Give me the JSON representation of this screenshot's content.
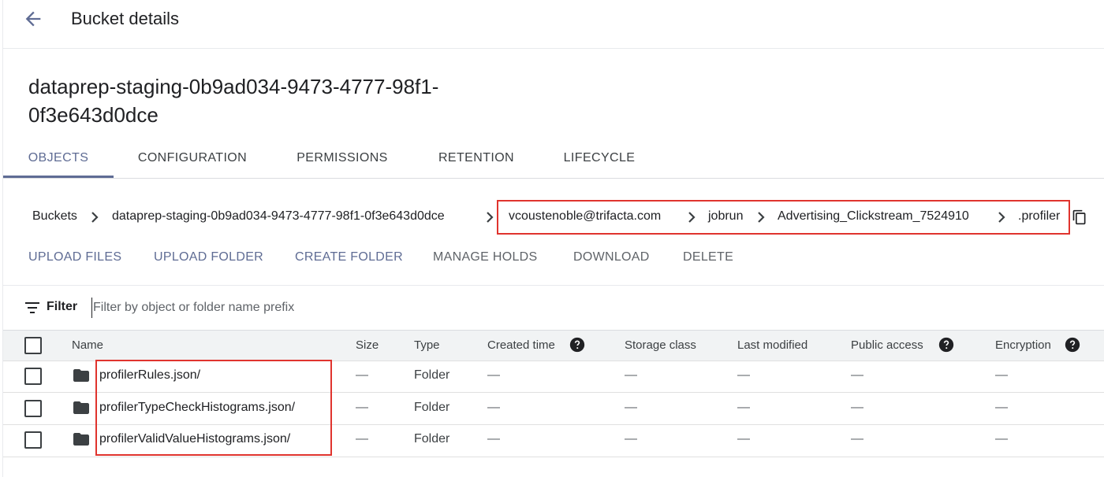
{
  "header": {
    "title": "Bucket details",
    "back_icon": "arrow-back-icon"
  },
  "bucket": {
    "name_line1": "dataprep-staging-0b9ad034-9473-4777-98f1-",
    "name_line2": "0f3e643d0dce"
  },
  "tabs": [
    {
      "label": "OBJECTS",
      "active": true
    },
    {
      "label": "CONFIGURATION",
      "active": false
    },
    {
      "label": "PERMISSIONS",
      "active": false
    },
    {
      "label": "RETENTION",
      "active": false
    },
    {
      "label": "LIFECYCLE",
      "active": false
    }
  ],
  "breadcrumb": [
    "Buckets",
    "dataprep-staging-0b9ad034-9473-4777-98f1-0f3e643d0dce",
    "vcoustenoble@trifacta.com",
    "jobrun",
    "Advertising_Clickstream_7524910",
    ".profiler"
  ],
  "actions": [
    {
      "label": "UPLOAD FILES",
      "enabled": true
    },
    {
      "label": "UPLOAD FOLDER",
      "enabled": true
    },
    {
      "label": "CREATE FOLDER",
      "enabled": true
    },
    {
      "label": "MANAGE HOLDS",
      "enabled": false
    },
    {
      "label": "DOWNLOAD",
      "enabled": false
    },
    {
      "label": "DELETE",
      "enabled": false
    }
  ],
  "filter": {
    "label": "Filter",
    "placeholder": "Filter by object or folder name prefix"
  },
  "table": {
    "columns": [
      "Name",
      "Size",
      "Type",
      "Created time",
      "Storage class",
      "Last modified",
      "Public access",
      "Encryption"
    ],
    "rows": [
      {
        "name": "profilerRules.json/",
        "size": "—",
        "type": "Folder",
        "created": "—",
        "storage_class": "—",
        "last_modified": "—",
        "public_access": "—",
        "encryption": "—"
      },
      {
        "name": "profilerTypeCheckHistograms.json/",
        "size": "—",
        "type": "Folder",
        "created": "—",
        "storage_class": "—",
        "last_modified": "—",
        "public_access": "—",
        "encryption": "—"
      },
      {
        "name": "profilerValidValueHistograms.json/",
        "size": "—",
        "type": "Folder",
        "created": "—",
        "storage_class": "—",
        "last_modified": "—",
        "public_access": "—",
        "encryption": "—"
      }
    ]
  },
  "colors": {
    "accent": "#5f6c94",
    "highlight": "#e0342e",
    "header_bg": "#f1f3f4"
  }
}
